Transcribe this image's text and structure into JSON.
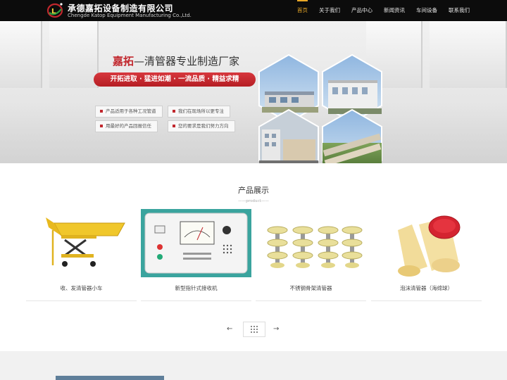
{
  "header": {
    "brand_cn": "承德嘉拓设备制造有限公司",
    "brand_en": "Chengde Katop Equipment Manufacturing Co.,Ltd.",
    "nav": [
      "首页",
      "关于我们",
      "产品中心",
      "新闻资讯",
      "车间设备",
      "联系我们"
    ],
    "active_nav_index": 0,
    "accent_color": "#e9a827"
  },
  "banner": {
    "brand_word": "嘉拓",
    "title_rest": "—清管器专业制造厂家",
    "slogan": "开拓进取 · 猛进如潮 · 一流品质 · 精益求精",
    "features": [
      "产品适用于各种工况管道",
      "我们在现场所以更专注",
      "用最好的产品回报信任",
      "您的要求是我们努力方向"
    ],
    "slogan_color": "#c1272d"
  },
  "products": {
    "title": "产品展示",
    "subtitle": "——product——",
    "items": [
      {
        "caption": "收、发清管器小车",
        "icon": "trolley-image"
      },
      {
        "caption": "新型指针式接收机",
        "icon": "receiver-image"
      },
      {
        "caption": "不锈钢骨架清管器",
        "icon": "pig-image"
      },
      {
        "caption": "泡沫清管器（海绵球）",
        "icon": "foam-pig-image"
      }
    ]
  },
  "pager": {
    "prev": "←",
    "next": "→"
  }
}
